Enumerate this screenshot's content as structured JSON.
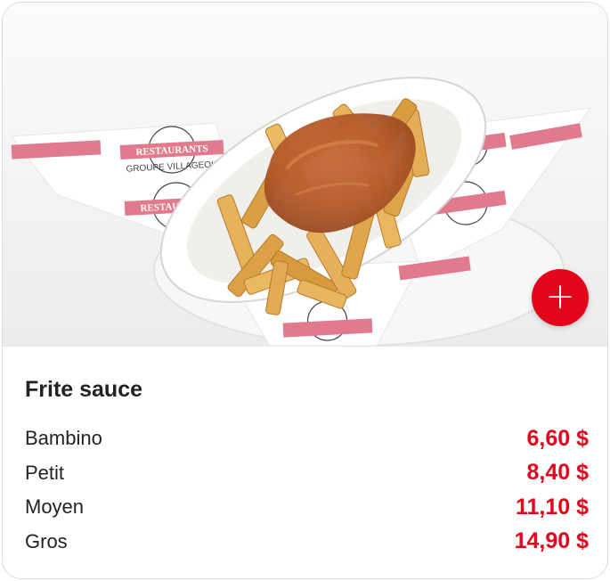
{
  "item": {
    "name": "Frite sauce",
    "image_alt": "Frite sauce dans un plat blanc",
    "add_icon": "plus-icon"
  },
  "sizes": [
    {
      "label": "Bambino",
      "price": "6,60 $"
    },
    {
      "label": "Petit",
      "price": "8,40 $"
    },
    {
      "label": "Moyen",
      "price": "11,10 $"
    },
    {
      "label": "Gros",
      "price": "14,90 $"
    }
  ],
  "paper": {
    "brand_line1": "RESTAURANTS",
    "brand_line2": "GROUPE VILLAGEOIS"
  },
  "colors": {
    "accent": "#e3061b",
    "text": "#222222"
  }
}
